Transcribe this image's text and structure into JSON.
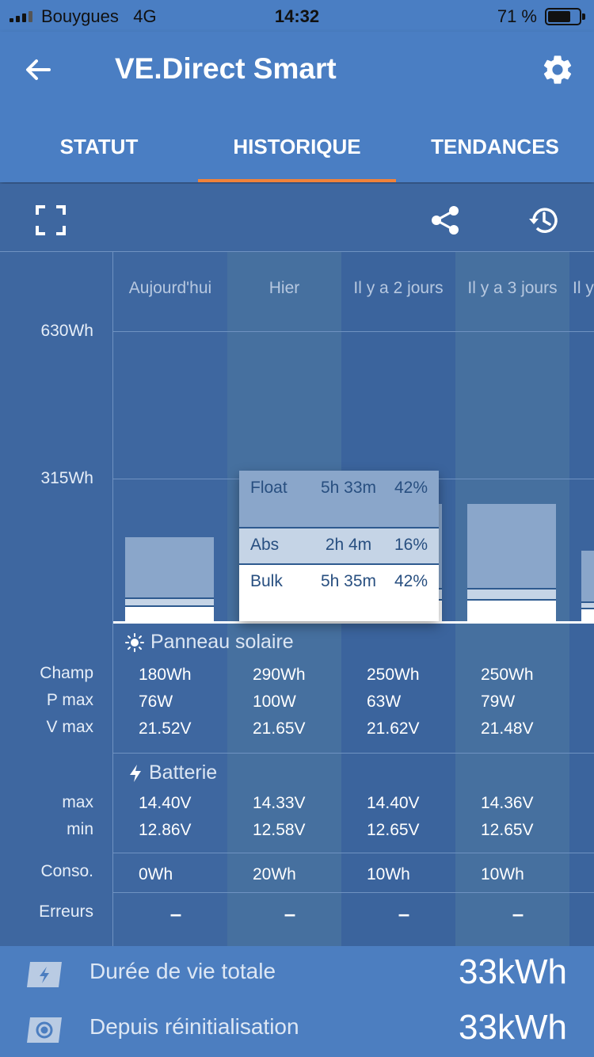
{
  "status_bar": {
    "carrier": "Bouygues",
    "network": "4G",
    "time": "14:32",
    "battery_percent": "71 %"
  },
  "app": {
    "title": "VE.Direct Smart"
  },
  "tabs": [
    {
      "label": "STATUT",
      "active": false
    },
    {
      "label": "HISTORIQUE",
      "active": true
    },
    {
      "label": "TENDANCES",
      "active": false
    }
  ],
  "colors": {
    "accent": "#f0823a",
    "bar_float": "#8aa6ca",
    "bar_abs": "#c5d4e6",
    "bar_bulk": "#ffffff"
  },
  "chart_data": {
    "type": "bar",
    "y_ticks": [
      "630Wh",
      "315Wh"
    ],
    "categories": [
      "Aujourd'hui",
      "Hier",
      "Il y a 2 jours",
      "Il y a 3 jours",
      "Il y"
    ],
    "yield_wh": [
      180,
      290,
      250,
      250,
      150
    ],
    "tooltip": {
      "rows": [
        {
          "phase": "Float",
          "duration": "5h 33m",
          "percent": "42%"
        },
        {
          "phase": "Abs",
          "duration": "2h 4m",
          "percent": "16%"
        },
        {
          "phase": "Bulk",
          "duration": "5h 35m",
          "percent": "42%"
        }
      ]
    }
  },
  "solar": {
    "title": "Panneau solaire",
    "row_labels": [
      "Champ",
      "P max",
      "V max"
    ],
    "days": [
      {
        "yield": "180Wh",
        "pmax": "76W",
        "vmax": "21.52V"
      },
      {
        "yield": "290Wh",
        "pmax": "100W",
        "vmax": "21.65V"
      },
      {
        "yield": "250Wh",
        "pmax": "63W",
        "vmax": "21.62V"
      },
      {
        "yield": "250Wh",
        "pmax": "79W",
        "vmax": "21.48V"
      }
    ]
  },
  "battery": {
    "title": "Batterie",
    "row_labels": [
      "max",
      "min"
    ],
    "days": [
      {
        "max": "14.40V",
        "min": "12.86V"
      },
      {
        "max": "14.33V",
        "min": "12.58V"
      },
      {
        "max": "14.40V",
        "min": "12.65V"
      },
      {
        "max": "14.36V",
        "min": "12.65V"
      }
    ]
  },
  "consumption": {
    "label": "Conso.",
    "values": [
      "0Wh",
      "20Wh",
      "10Wh",
      "10Wh"
    ]
  },
  "errors": {
    "label": "Erreurs",
    "values": [
      "–",
      "–",
      "–",
      "–"
    ]
  },
  "footer": [
    {
      "label": "Durée de vie totale",
      "value": "33kWh",
      "icon": "bolt-icon"
    },
    {
      "label": "Depuis réinitialisation",
      "value": "33kWh",
      "icon": "reset-icon"
    }
  ]
}
